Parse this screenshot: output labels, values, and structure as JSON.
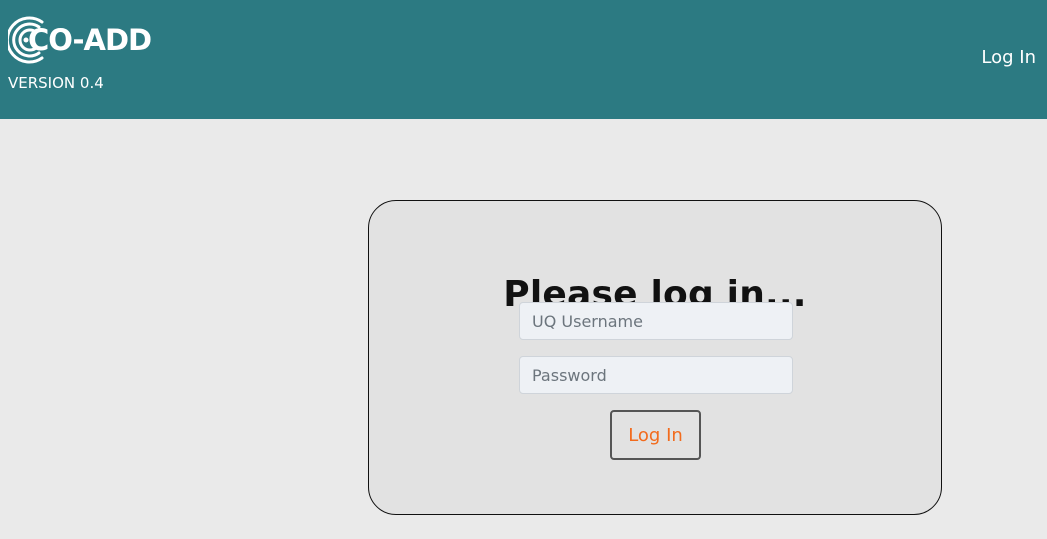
{
  "header": {
    "logo_text": "CO-ADD",
    "version": "VERSION 0.4",
    "nav_login": "Log In"
  },
  "login_card": {
    "title": "Please log in...",
    "username_placeholder": "UQ Username",
    "password_placeholder": "Password",
    "submit_label": "Log In"
  },
  "colors": {
    "header_bg": "#2c7a82",
    "page_bg": "#eaeaea",
    "card_bg": "#e2e2e2",
    "button_text": "#f26b1d"
  },
  "icons": {
    "logo": "co-add-logo-icon"
  }
}
